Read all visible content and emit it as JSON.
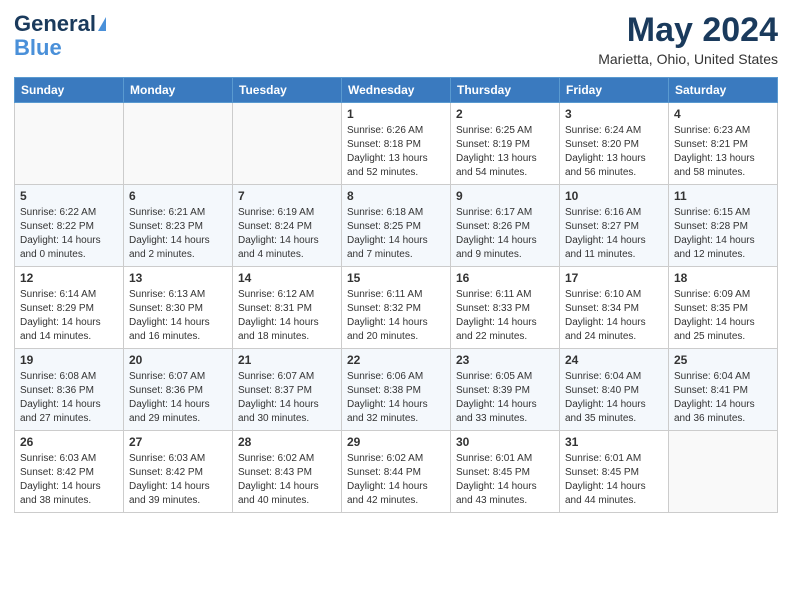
{
  "header": {
    "logo_line1": "General",
    "logo_line2": "Blue",
    "month_title": "May 2024",
    "location": "Marietta, Ohio, United States"
  },
  "days_of_week": [
    "Sunday",
    "Monday",
    "Tuesday",
    "Wednesday",
    "Thursday",
    "Friday",
    "Saturday"
  ],
  "weeks": [
    [
      {
        "day": "",
        "sunrise": "",
        "sunset": "",
        "daylight": ""
      },
      {
        "day": "",
        "sunrise": "",
        "sunset": "",
        "daylight": ""
      },
      {
        "day": "",
        "sunrise": "",
        "sunset": "",
        "daylight": ""
      },
      {
        "day": "1",
        "sunrise": "Sunrise: 6:26 AM",
        "sunset": "Sunset: 8:18 PM",
        "daylight": "Daylight: 13 hours and 52 minutes."
      },
      {
        "day": "2",
        "sunrise": "Sunrise: 6:25 AM",
        "sunset": "Sunset: 8:19 PM",
        "daylight": "Daylight: 13 hours and 54 minutes."
      },
      {
        "day": "3",
        "sunrise": "Sunrise: 6:24 AM",
        "sunset": "Sunset: 8:20 PM",
        "daylight": "Daylight: 13 hours and 56 minutes."
      },
      {
        "day": "4",
        "sunrise": "Sunrise: 6:23 AM",
        "sunset": "Sunset: 8:21 PM",
        "daylight": "Daylight: 13 hours and 58 minutes."
      }
    ],
    [
      {
        "day": "5",
        "sunrise": "Sunrise: 6:22 AM",
        "sunset": "Sunset: 8:22 PM",
        "daylight": "Daylight: 14 hours and 0 minutes."
      },
      {
        "day": "6",
        "sunrise": "Sunrise: 6:21 AM",
        "sunset": "Sunset: 8:23 PM",
        "daylight": "Daylight: 14 hours and 2 minutes."
      },
      {
        "day": "7",
        "sunrise": "Sunrise: 6:19 AM",
        "sunset": "Sunset: 8:24 PM",
        "daylight": "Daylight: 14 hours and 4 minutes."
      },
      {
        "day": "8",
        "sunrise": "Sunrise: 6:18 AM",
        "sunset": "Sunset: 8:25 PM",
        "daylight": "Daylight: 14 hours and 7 minutes."
      },
      {
        "day": "9",
        "sunrise": "Sunrise: 6:17 AM",
        "sunset": "Sunset: 8:26 PM",
        "daylight": "Daylight: 14 hours and 9 minutes."
      },
      {
        "day": "10",
        "sunrise": "Sunrise: 6:16 AM",
        "sunset": "Sunset: 8:27 PM",
        "daylight": "Daylight: 14 hours and 11 minutes."
      },
      {
        "day": "11",
        "sunrise": "Sunrise: 6:15 AM",
        "sunset": "Sunset: 8:28 PM",
        "daylight": "Daylight: 14 hours and 12 minutes."
      }
    ],
    [
      {
        "day": "12",
        "sunrise": "Sunrise: 6:14 AM",
        "sunset": "Sunset: 8:29 PM",
        "daylight": "Daylight: 14 hours and 14 minutes."
      },
      {
        "day": "13",
        "sunrise": "Sunrise: 6:13 AM",
        "sunset": "Sunset: 8:30 PM",
        "daylight": "Daylight: 14 hours and 16 minutes."
      },
      {
        "day": "14",
        "sunrise": "Sunrise: 6:12 AM",
        "sunset": "Sunset: 8:31 PM",
        "daylight": "Daylight: 14 hours and 18 minutes."
      },
      {
        "day": "15",
        "sunrise": "Sunrise: 6:11 AM",
        "sunset": "Sunset: 8:32 PM",
        "daylight": "Daylight: 14 hours and 20 minutes."
      },
      {
        "day": "16",
        "sunrise": "Sunrise: 6:11 AM",
        "sunset": "Sunset: 8:33 PM",
        "daylight": "Daylight: 14 hours and 22 minutes."
      },
      {
        "day": "17",
        "sunrise": "Sunrise: 6:10 AM",
        "sunset": "Sunset: 8:34 PM",
        "daylight": "Daylight: 14 hours and 24 minutes."
      },
      {
        "day": "18",
        "sunrise": "Sunrise: 6:09 AM",
        "sunset": "Sunset: 8:35 PM",
        "daylight": "Daylight: 14 hours and 25 minutes."
      }
    ],
    [
      {
        "day": "19",
        "sunrise": "Sunrise: 6:08 AM",
        "sunset": "Sunset: 8:36 PM",
        "daylight": "Daylight: 14 hours and 27 minutes."
      },
      {
        "day": "20",
        "sunrise": "Sunrise: 6:07 AM",
        "sunset": "Sunset: 8:36 PM",
        "daylight": "Daylight: 14 hours and 29 minutes."
      },
      {
        "day": "21",
        "sunrise": "Sunrise: 6:07 AM",
        "sunset": "Sunset: 8:37 PM",
        "daylight": "Daylight: 14 hours and 30 minutes."
      },
      {
        "day": "22",
        "sunrise": "Sunrise: 6:06 AM",
        "sunset": "Sunset: 8:38 PM",
        "daylight": "Daylight: 14 hours and 32 minutes."
      },
      {
        "day": "23",
        "sunrise": "Sunrise: 6:05 AM",
        "sunset": "Sunset: 8:39 PM",
        "daylight": "Daylight: 14 hours and 33 minutes."
      },
      {
        "day": "24",
        "sunrise": "Sunrise: 6:04 AM",
        "sunset": "Sunset: 8:40 PM",
        "daylight": "Daylight: 14 hours and 35 minutes."
      },
      {
        "day": "25",
        "sunrise": "Sunrise: 6:04 AM",
        "sunset": "Sunset: 8:41 PM",
        "daylight": "Daylight: 14 hours and 36 minutes."
      }
    ],
    [
      {
        "day": "26",
        "sunrise": "Sunrise: 6:03 AM",
        "sunset": "Sunset: 8:42 PM",
        "daylight": "Daylight: 14 hours and 38 minutes."
      },
      {
        "day": "27",
        "sunrise": "Sunrise: 6:03 AM",
        "sunset": "Sunset: 8:42 PM",
        "daylight": "Daylight: 14 hours and 39 minutes."
      },
      {
        "day": "28",
        "sunrise": "Sunrise: 6:02 AM",
        "sunset": "Sunset: 8:43 PM",
        "daylight": "Daylight: 14 hours and 40 minutes."
      },
      {
        "day": "29",
        "sunrise": "Sunrise: 6:02 AM",
        "sunset": "Sunset: 8:44 PM",
        "daylight": "Daylight: 14 hours and 42 minutes."
      },
      {
        "day": "30",
        "sunrise": "Sunrise: 6:01 AM",
        "sunset": "Sunset: 8:45 PM",
        "daylight": "Daylight: 14 hours and 43 minutes."
      },
      {
        "day": "31",
        "sunrise": "Sunrise: 6:01 AM",
        "sunset": "Sunset: 8:45 PM",
        "daylight": "Daylight: 14 hours and 44 minutes."
      },
      {
        "day": "",
        "sunrise": "",
        "sunset": "",
        "daylight": ""
      }
    ]
  ]
}
